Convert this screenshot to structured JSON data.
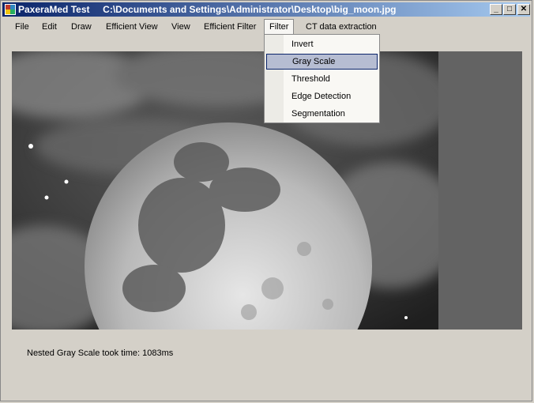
{
  "window": {
    "title": "PaxeraMed Test     C:\\Documents and Settings\\Administrator\\Desktop\\big_moon.jpg",
    "minimize_glyph": "_",
    "maximize_glyph": "□",
    "close_glyph": "✕"
  },
  "menu": {
    "file": "File",
    "edit": "Edit",
    "draw": "Draw",
    "efficient_view": "Efficient View",
    "view": "View",
    "efficient_filter": "Efficient Filter",
    "filter": "Filter",
    "ct_data_extraction": "CT data extraction"
  },
  "filter_menu": {
    "items": [
      "Invert",
      "Gray Scale",
      "Threshold",
      "Edge Detection",
      "Segmentation"
    ],
    "selected": "Gray Scale"
  },
  "status": {
    "text": "Nested Gray Scale took time: 1083ms"
  },
  "colors": {
    "titlebar_start": "#0a246a",
    "titlebar_end": "#a6caf0",
    "selection": "#b6bdd2"
  },
  "icons": {
    "app": "app-icon"
  }
}
